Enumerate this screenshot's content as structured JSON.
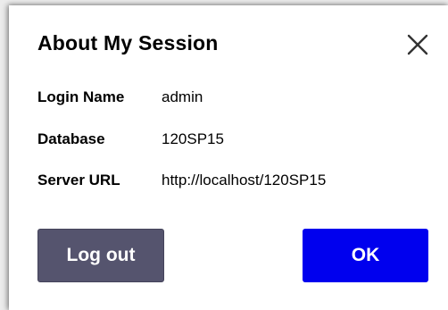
{
  "dialog": {
    "title": "About My Session",
    "close_icon": "close-icon"
  },
  "session": {
    "rows": [
      {
        "label": "Login Name",
        "value": "admin"
      },
      {
        "label": "Database",
        "value": "120SP15"
      },
      {
        "label": "Server URL",
        "value": "http://localhost/120SP15"
      }
    ]
  },
  "buttons": {
    "logout_label": "Log out",
    "ok_label": "OK"
  },
  "colors": {
    "logout_bg": "#55546e",
    "ok_bg": "#0000ee",
    "text": "#000000"
  }
}
